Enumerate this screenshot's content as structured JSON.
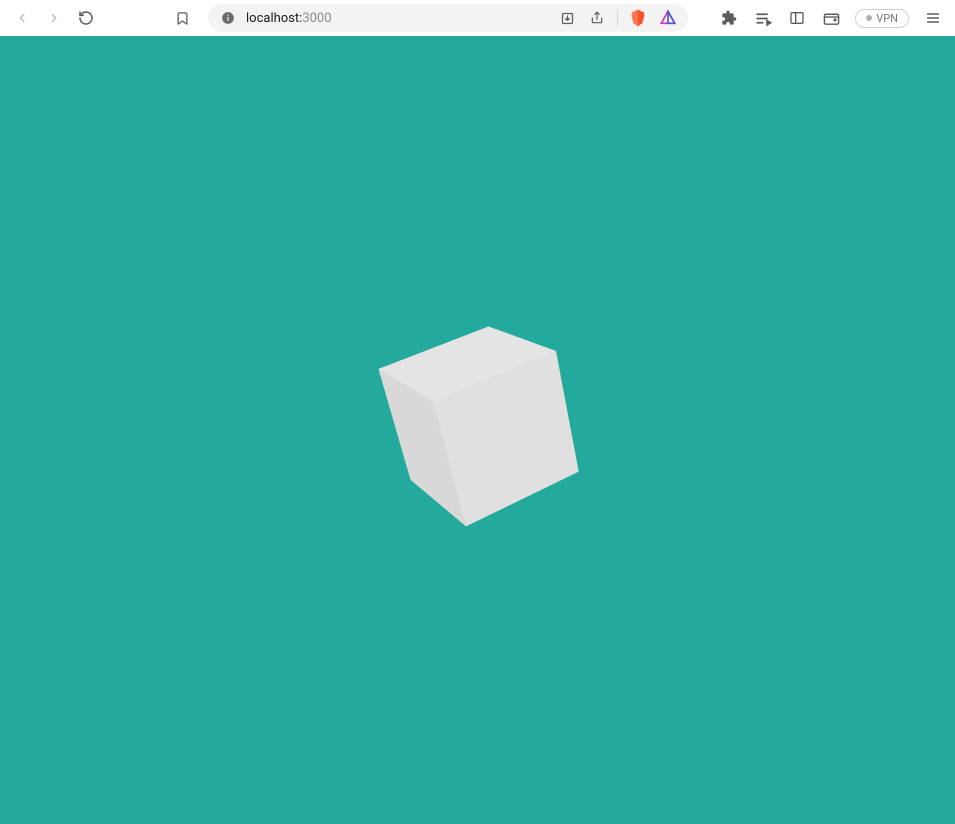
{
  "browser": {
    "address": {
      "host": "localhost:",
      "port": "3000"
    },
    "vpn_label": "VPN"
  },
  "page": {
    "background_color": "#23aa9d",
    "object": "cube"
  }
}
